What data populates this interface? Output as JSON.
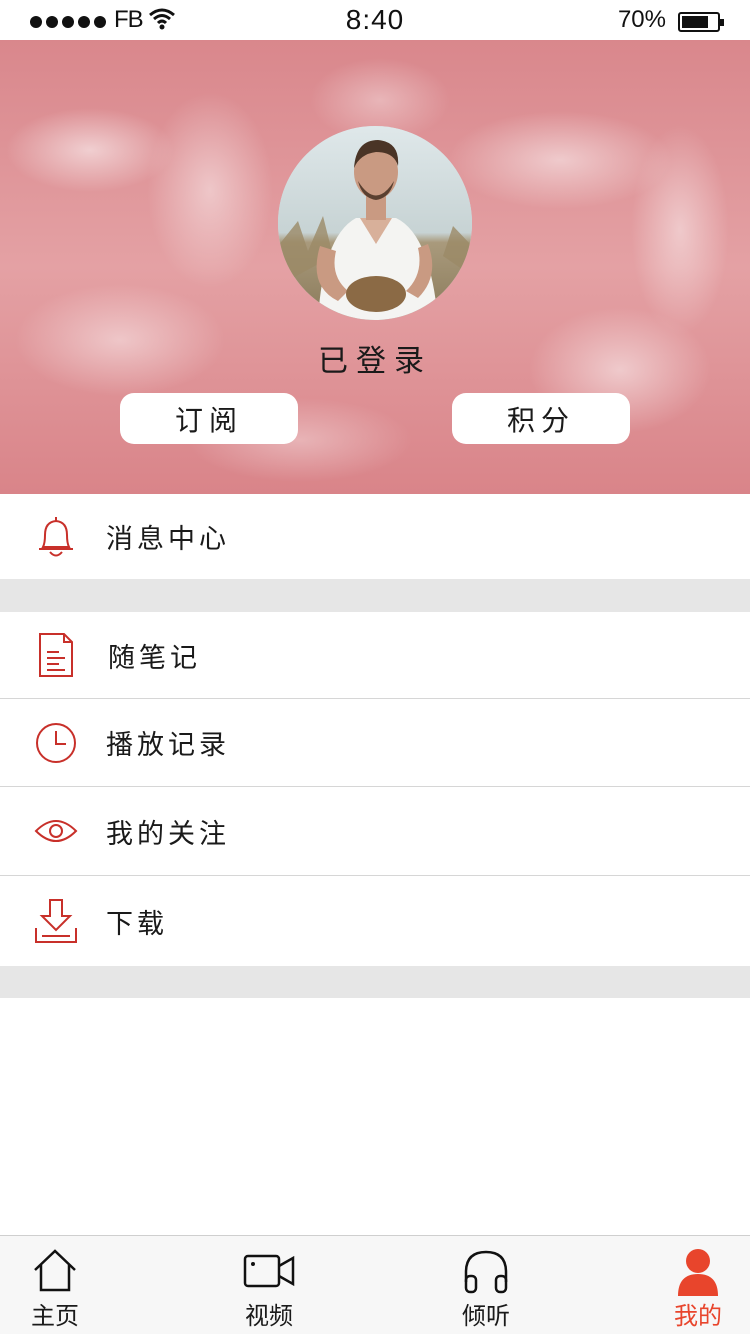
{
  "status_bar": {
    "carrier": "FB",
    "time": "8:40",
    "battery": "70%"
  },
  "profile": {
    "status": "已登录",
    "buttons": {
      "subscribe": "订阅",
      "points": "积分"
    }
  },
  "menu": {
    "messages": "消息中心",
    "notes": "随笔记",
    "history": "播放记录",
    "following": "我的关注",
    "download": "下载"
  },
  "tabs": {
    "home": "主页",
    "video": "视频",
    "listen": "倾听",
    "mine": "我的"
  },
  "colors": {
    "accent": "#e8452c",
    "icon_red": "#c8302a",
    "header_pink": "#d9878c"
  },
  "icons": {
    "messages": "bell-icon",
    "notes": "document-icon",
    "history": "clock-icon",
    "following": "eye-icon",
    "download": "download-icon"
  }
}
